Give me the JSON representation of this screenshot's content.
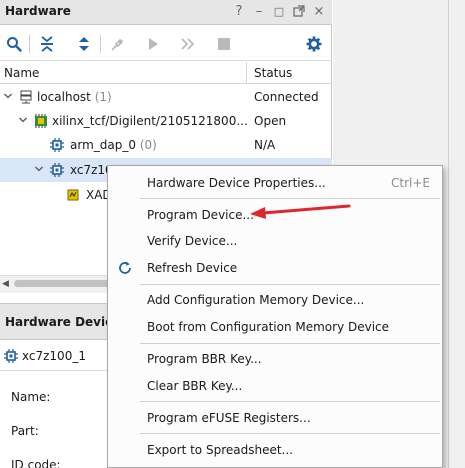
{
  "hardware_panel": {
    "title": "Hardware",
    "window_controls": [
      "?",
      "–",
      "□",
      "×"
    ],
    "columns": {
      "name": "Name",
      "status": "Status"
    },
    "tree": [
      {
        "label": "localhost",
        "count": "(1)",
        "status": "Connected",
        "icon": "server-icon"
      },
      {
        "label": "xilinx_tcf/Digilent/2105121800...",
        "count": "",
        "status": "Open",
        "icon": "jtag-target-icon"
      },
      {
        "label": "arm_dap_0",
        "count": "(0)",
        "status": "N/A",
        "icon": "chip-icon"
      },
      {
        "label": "xc7z10",
        "count": "",
        "status": "",
        "icon": "chip-icon"
      },
      {
        "label": "XAD",
        "count": "",
        "status": "",
        "icon": "xadc-icon"
      }
    ]
  },
  "properties_panel": {
    "title": "Hardware Device I",
    "device": "xc7z100_1",
    "labels": [
      "Name:",
      "Part:",
      "ID code:"
    ]
  },
  "context_menu": {
    "items": [
      {
        "label": "Hardware Device Properties...",
        "shortcut": "Ctrl+E"
      },
      {
        "label": "Program Device...",
        "shortcut": ""
      },
      {
        "label": "Verify Device...",
        "shortcut": ""
      },
      {
        "label": "Refresh Device",
        "shortcut": ""
      },
      {
        "label": "Add Configuration Memory Device...",
        "shortcut": ""
      },
      {
        "label": "Boot from Configuration Memory Device",
        "shortcut": ""
      },
      {
        "label": "Program BBR Key...",
        "shortcut": ""
      },
      {
        "label": "Clear BBR Key...",
        "shortcut": ""
      },
      {
        "label": "Program eFUSE Registers...",
        "shortcut": ""
      },
      {
        "label": "Export to Spreadsheet...",
        "shortcut": ""
      }
    ]
  },
  "colors": {
    "accent_blue": "#1f5fa8",
    "selection": "#d9e6f7",
    "annotation_arrow": "#e0262d"
  }
}
